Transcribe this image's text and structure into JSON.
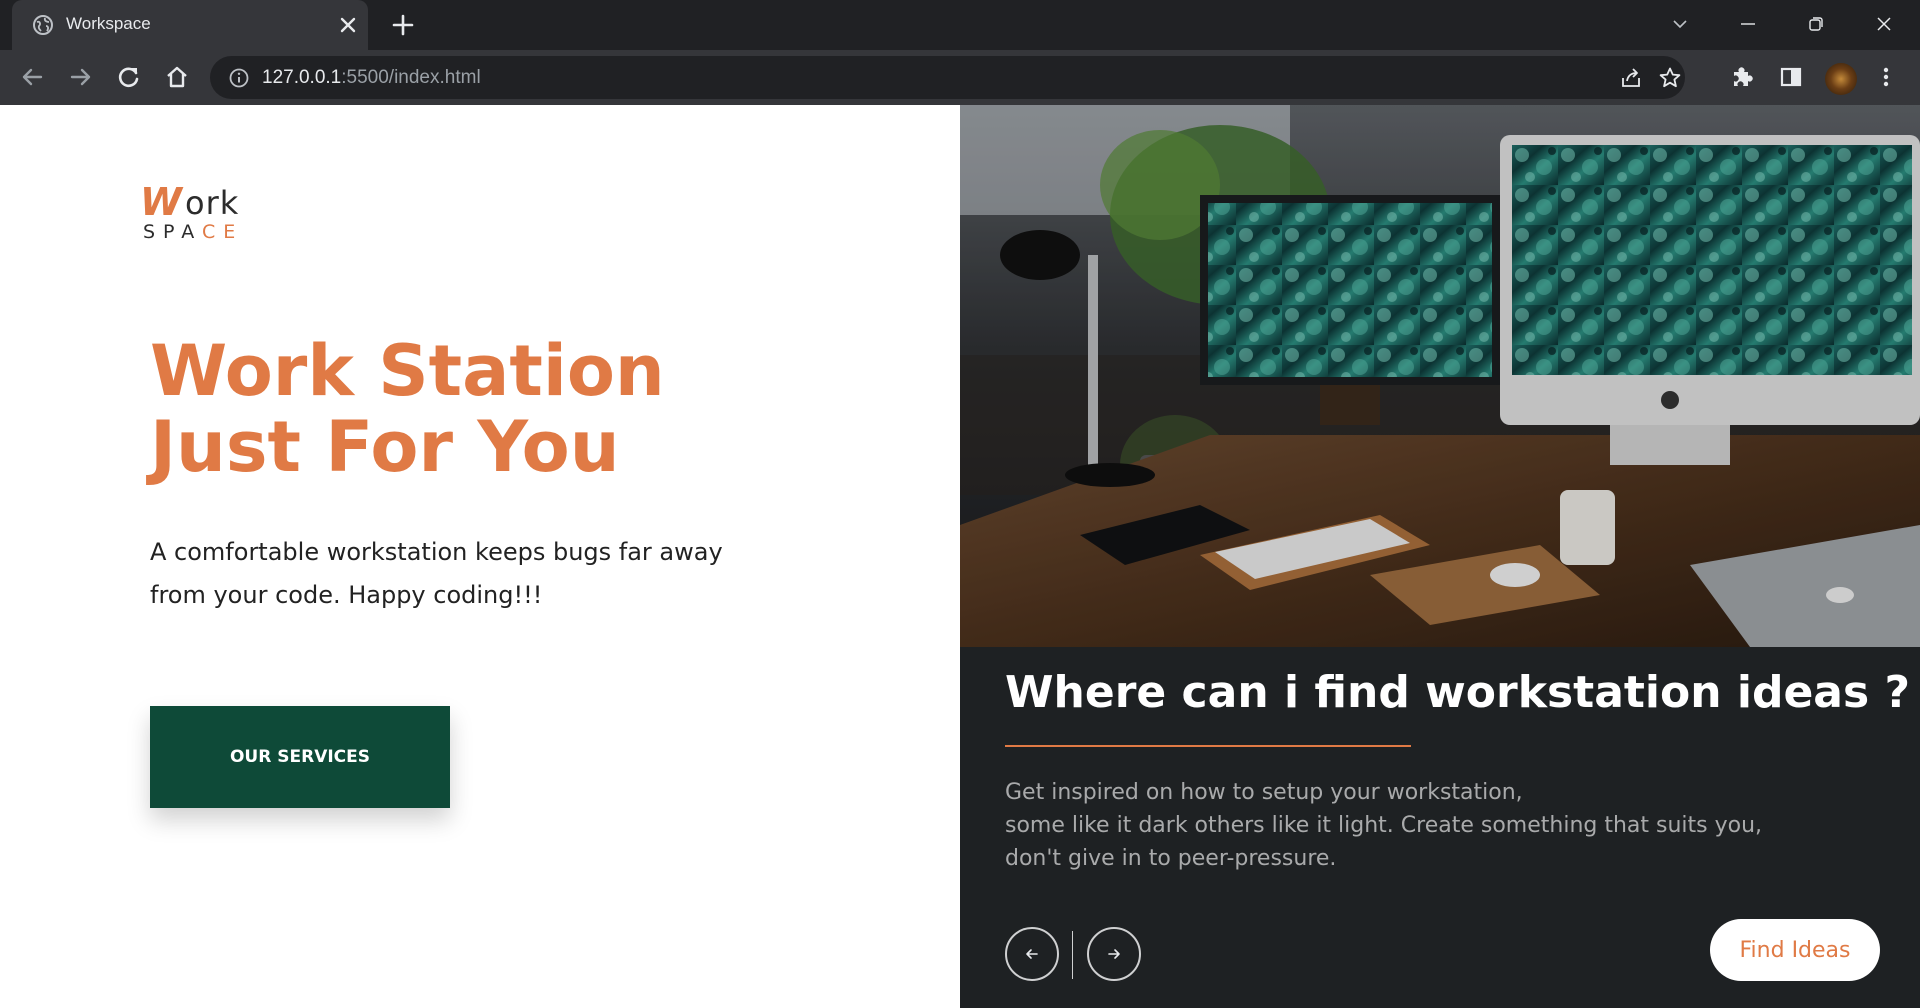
{
  "browser": {
    "tab_title": "Workspace",
    "url_host": "127.0.0.1",
    "url_rest": ":5500/index.html"
  },
  "icons": {
    "tab": "globe-icon",
    "tab_close": "close-icon",
    "new_tab": "plus-icon",
    "back": "arrow-left-icon",
    "forward": "arrow-right-icon",
    "reload": "reload-icon",
    "home": "home-icon",
    "site_info": "info-icon",
    "share": "share-icon",
    "bookmark": "star-icon",
    "extensions": "puzzle-icon",
    "side_panel": "side-panel-icon",
    "menu": "kebab-menu-icon"
  },
  "logo": {
    "w": "W",
    "ork": "ork",
    "spa": "SPA",
    "ce": "CE"
  },
  "hero": {
    "title_line1": "Work Station",
    "title_line2": "Just For You",
    "desc_line1": "A comfortable workstation keeps bugs far away",
    "desc_line2": "from your code. Happy coding!!!",
    "button": "OUR SERVICES"
  },
  "card": {
    "title": "Where can i find workstation ideas ?",
    "desc_line1": "Get inspired on how to setup your workstation,",
    "desc_line2": "some like it dark others like it light. Create something that suits you,",
    "desc_line3": "don't give in to peer-pressure.",
    "button": "Find Ideas"
  },
  "colors": {
    "accent": "#e07a45",
    "button_green": "#0e4a38",
    "panel_dark": "#1e2123",
    "chrome_dark": "#202124",
    "chrome_toolbar": "#35363a"
  }
}
